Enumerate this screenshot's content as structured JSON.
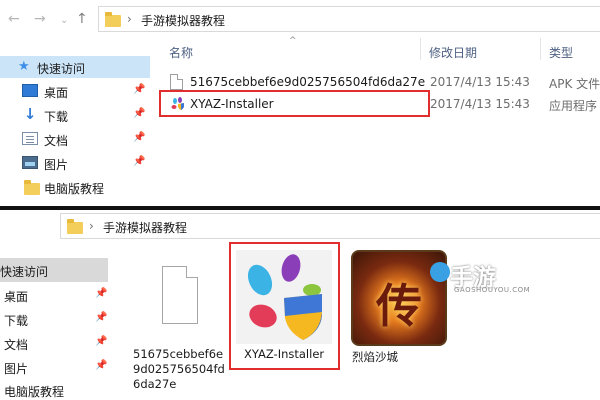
{
  "top_window": {
    "path": "手游模拟器教程",
    "sidebar": {
      "quick_access": "快速访问",
      "items": [
        {
          "label": "桌面",
          "icon": "desktop-icon"
        },
        {
          "label": "下载",
          "icon": "download-icon"
        },
        {
          "label": "文档",
          "icon": "documents-icon"
        },
        {
          "label": "图片",
          "icon": "pictures-icon"
        },
        {
          "label": "电脑版教程",
          "icon": "folder-icon"
        }
      ]
    },
    "columns": {
      "name": "名称",
      "date": "修改日期",
      "type": "类型"
    },
    "files": [
      {
        "name": "51675cebbef6e9d025756504fd6da27e",
        "date": "2017/4/13 15:43",
        "type": "APK 文件"
      },
      {
        "name": "XYAZ-Installer",
        "date": "2017/4/13 15:43",
        "type": "应用程序"
      }
    ]
  },
  "bottom_window": {
    "path": "手游模拟器教程",
    "sidebar": {
      "quick_access": "快速访问",
      "items": [
        "桌面",
        "下载",
        "文档",
        "图片",
        "电脑版教程"
      ]
    },
    "tiles": {
      "apk_lines": [
        "51675cebbef6e",
        "9d025756504fd",
        "6da27e"
      ],
      "installer": "XYAZ-Installer",
      "game": "烈焰沙城"
    }
  },
  "watermark": {
    "main": "手游",
    "sub": "GAOSHOUYOU.COM"
  },
  "colors": {
    "highlight": "#e02d2d",
    "selection": "#cce4f7",
    "folder": "#f3ce5b"
  }
}
